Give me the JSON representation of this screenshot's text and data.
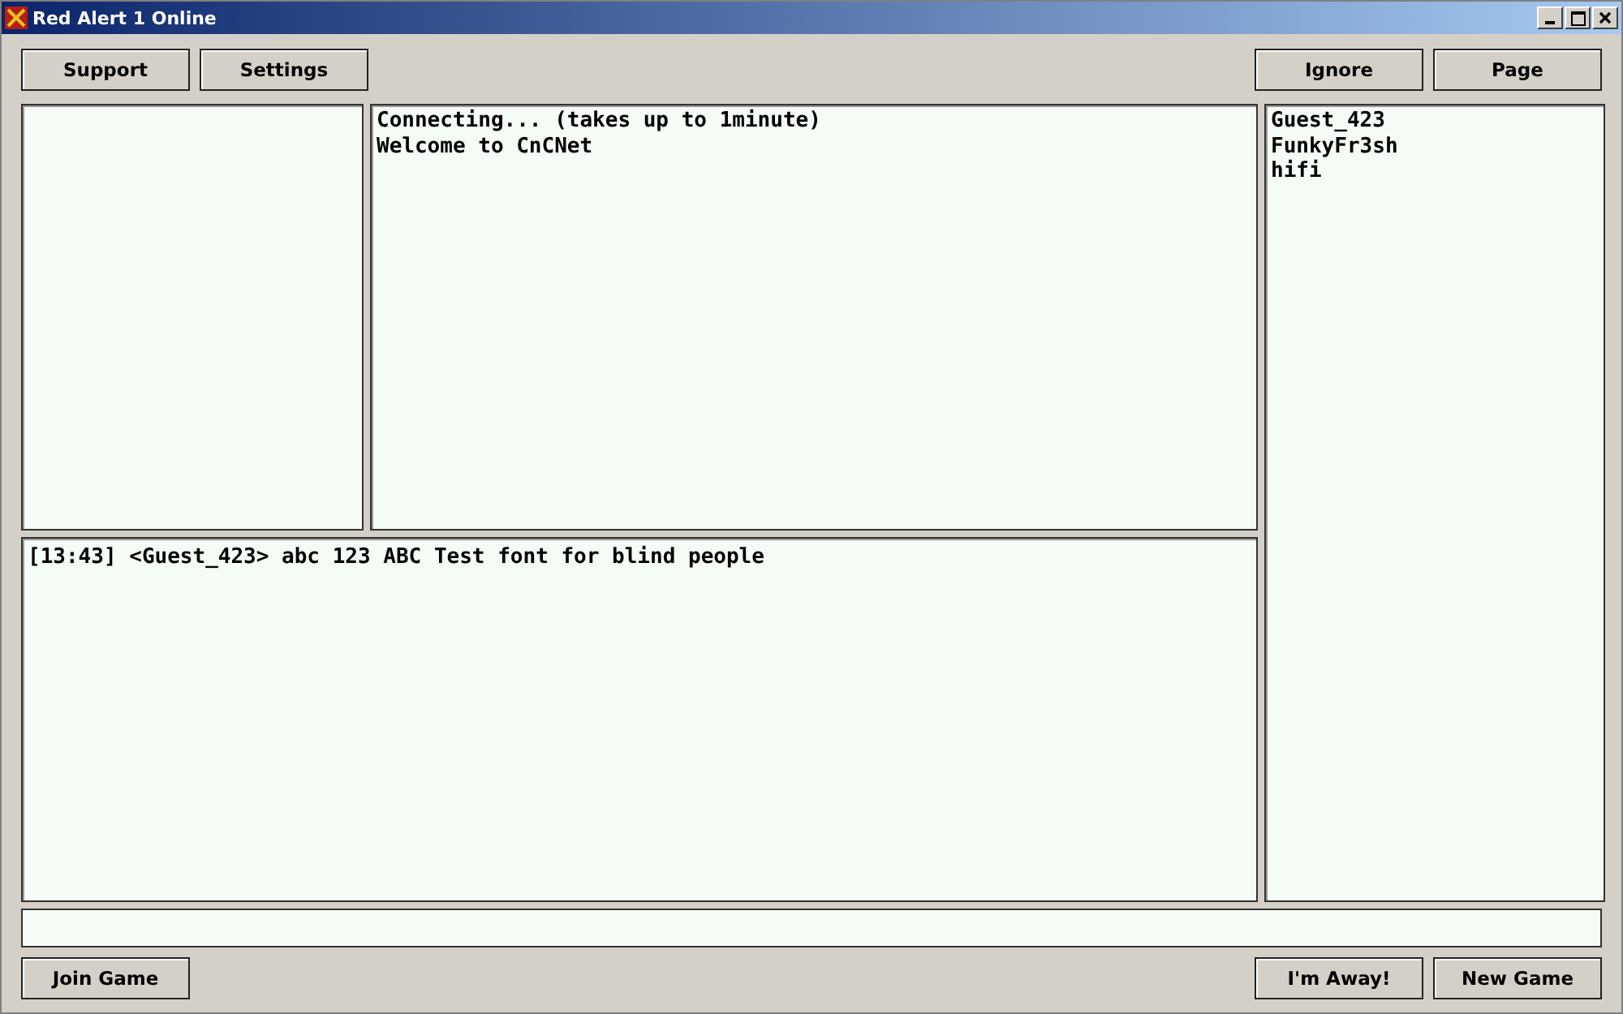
{
  "window": {
    "title": "Red Alert 1 Online"
  },
  "top_buttons_left": [
    "Support",
    "Settings"
  ],
  "top_buttons_right": [
    "Ignore",
    "Page"
  ],
  "status_log": [
    "Connecting... (takes up to 1minute)",
    "Welcome to CnCNet"
  ],
  "chat_log": [
    "[13:43] <Guest_423> abc 123 ABC Test font for blind people"
  ],
  "users": [
    "Guest_423",
    "FunkyFr3sh",
    "hifi"
  ],
  "bottom_buttons_left": [
    "Join Game"
  ],
  "bottom_buttons_right": [
    "I'm Away!",
    "New Game"
  ]
}
